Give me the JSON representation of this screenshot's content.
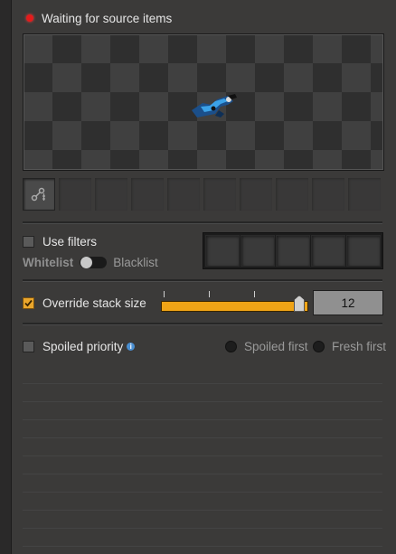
{
  "status": {
    "text": "Waiting for source items",
    "color": "#e41b1b"
  },
  "filters": {
    "use_filters_label": "Use filters",
    "use_filters_checked": false,
    "whitelist_label": "Whitelist",
    "blacklist_label": "Blacklist"
  },
  "stack": {
    "override_label": "Override stack size",
    "override_checked": true,
    "value": "12",
    "accent": "#f0a416"
  },
  "spoil": {
    "label": "Spoiled priority",
    "checked": false,
    "spoiled_first_label": "Spoiled first",
    "fresh_first_label": "Fresh first"
  },
  "icons": {
    "status": "status-red-dot-icon",
    "preview": "robot-arm-icon",
    "slot": "circuit-connection-icon",
    "info": "info-icon"
  }
}
